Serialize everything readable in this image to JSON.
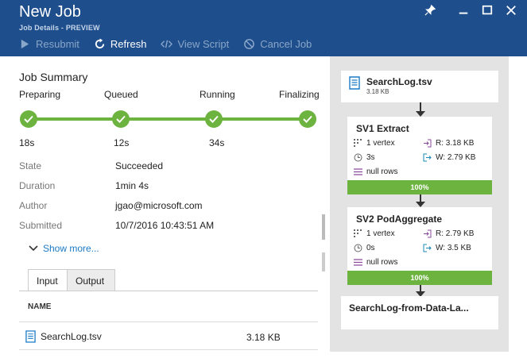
{
  "header": {
    "title": "New Job",
    "subtitle": "Job Details - PREVIEW",
    "toolbar": {
      "resubmit": "Resubmit",
      "refresh": "Refresh",
      "view_script": "View Script",
      "cancel_job": "Cancel Job"
    }
  },
  "summary": {
    "title": "Job Summary",
    "stages": [
      {
        "label": "Preparing",
        "duration": "18s"
      },
      {
        "label": "Queued",
        "duration": "12s"
      },
      {
        "label": "Running",
        "duration": "34s"
      },
      {
        "label": "Finalizing",
        "duration": ""
      }
    ],
    "details": [
      {
        "key": "State",
        "value": "Succeeded"
      },
      {
        "key": "Duration",
        "value": "1min 4s"
      },
      {
        "key": "Author",
        "value": "jgao@microsoft.com"
      },
      {
        "key": "Submitted",
        "value": "10/7/2016 10:43:51 AM"
      }
    ],
    "show_more": "Show more..."
  },
  "io": {
    "tabs": [
      "Input",
      "Output"
    ],
    "selected_tab": "Input",
    "column_header": "NAME",
    "rows": [
      {
        "name": "SearchLog.tsv",
        "size": "3.18 KB"
      }
    ]
  },
  "graph": {
    "input_node": {
      "name": "SearchLog.tsv",
      "size": "3.18 KB"
    },
    "stages": [
      {
        "name": "SV1 Extract",
        "vertices": "1 vertex",
        "time": "3s",
        "rows": "null rows",
        "read": "R: 3.18 KB",
        "write": "W: 2.79 KB",
        "progress": "100%"
      },
      {
        "name": "SV2 PodAggregate",
        "vertices": "1 vertex",
        "time": "0s",
        "rows": "null rows",
        "read": "R: 2.79 KB",
        "write": "W: 3.5 KB",
        "progress": "100%"
      }
    ],
    "output_node": {
      "name": "SearchLog-from-Data-La..."
    }
  },
  "colors": {
    "header_bg": "#1e4e8c",
    "success": "#6db33f",
    "link": "#1a7ac7"
  }
}
